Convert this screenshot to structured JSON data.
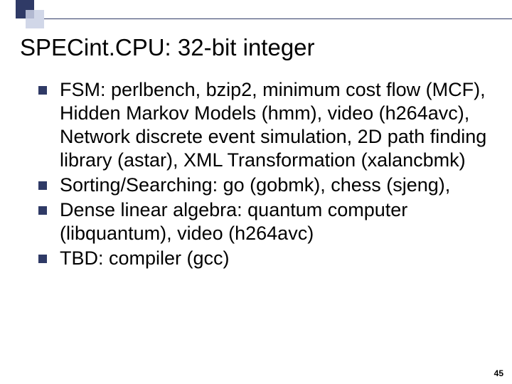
{
  "slide": {
    "title": "SPECint.CPU: 32-bit integer",
    "bullets": [
      "FSM: perlbench, bzip2, minimum cost flow (MCF), Hidden Markov Models (hmm), video (h264avc), Network discrete event simulation, 2D path finding library (astar), XML Transformation (xalancbmk)",
      "Sorting/Searching: go (gobmk), chess (sjeng),",
      "Dense linear algebra: quantum computer (libquantum), video (h264avc)",
      "TBD: compiler (gcc)"
    ],
    "page_number": "45"
  }
}
